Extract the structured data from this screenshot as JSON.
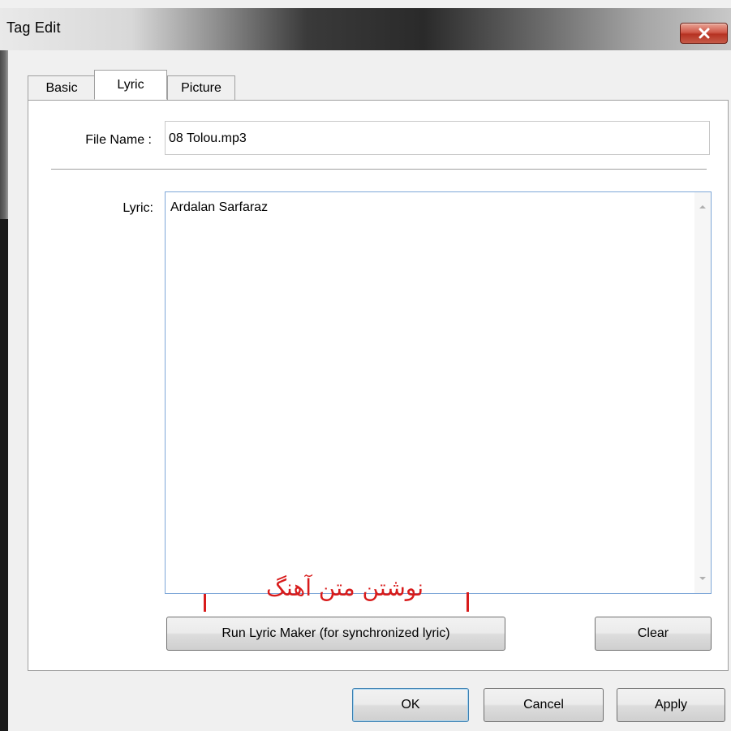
{
  "window": {
    "title": "Tag Edit"
  },
  "tabs": [
    {
      "label": "Basic"
    },
    {
      "label": "Lyric"
    },
    {
      "label": "Picture"
    }
  ],
  "fields": {
    "file_name_label": "File Name :",
    "file_name_value": "08 Tolou.mp3",
    "lyric_label": "Lyric:",
    "lyric_value": "Ardalan Sarfaraz"
  },
  "annotation": {
    "text": "نوشتن متن آهنگ"
  },
  "buttons": {
    "run_lyric_maker": "Run Lyric Maker (for synchronized lyric)",
    "clear": "Clear",
    "ok": "OK",
    "cancel": "Cancel",
    "apply": "Apply"
  },
  "colors": {
    "annotation": "#d81b1b",
    "close_button": "#c94a3a",
    "focus_border": "#7ea7d8"
  }
}
